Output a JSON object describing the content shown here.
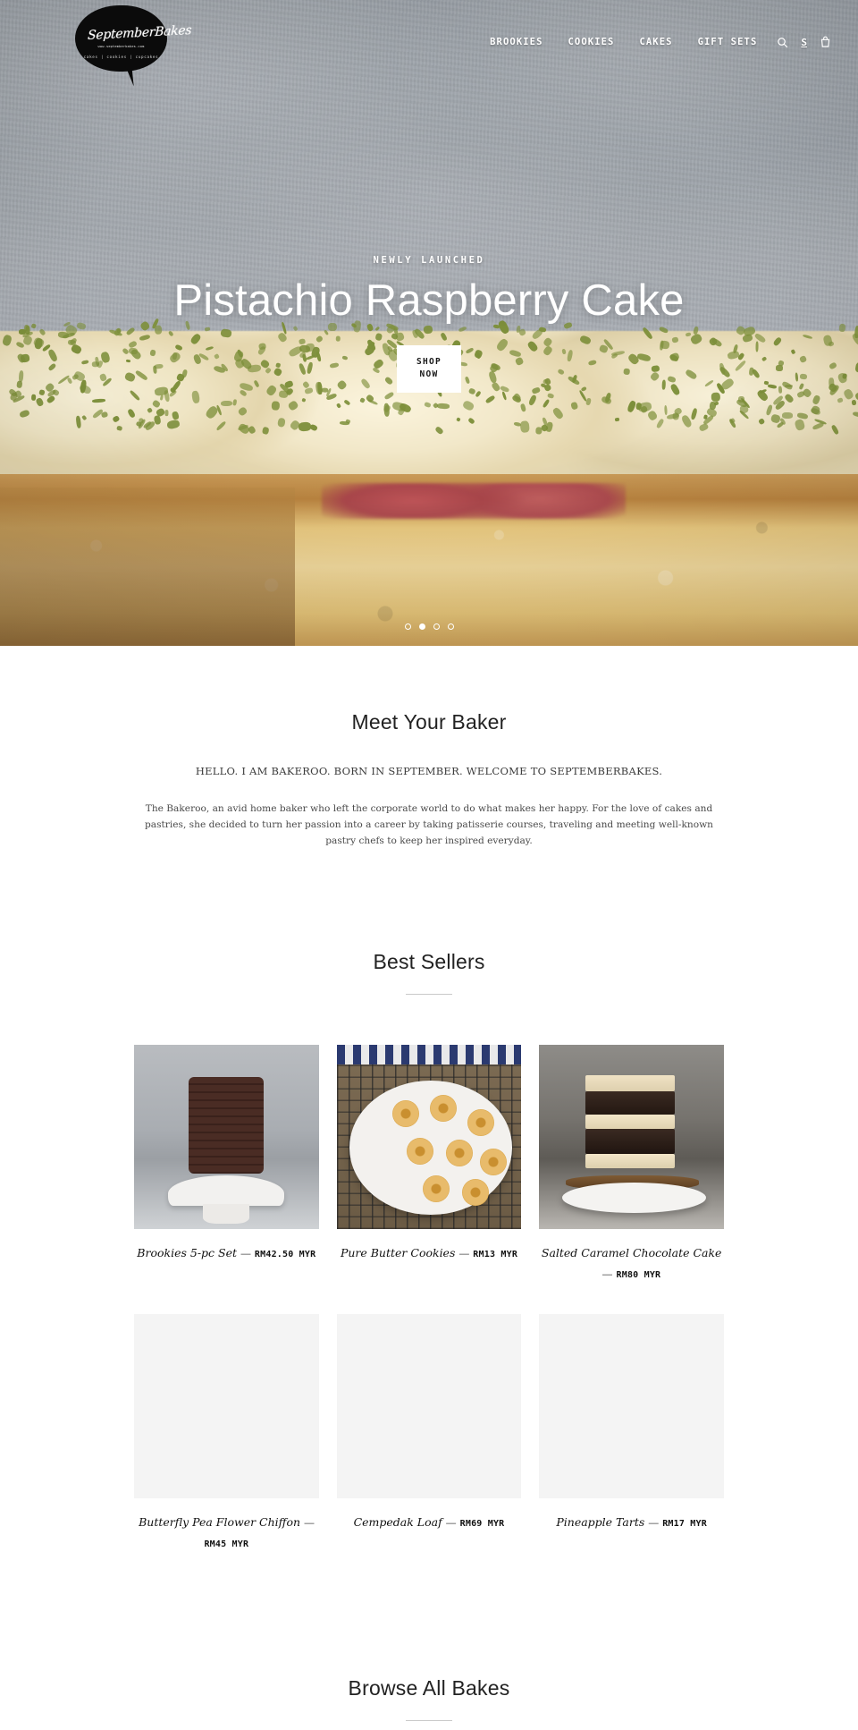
{
  "brand": {
    "name": "SeptemberBakes",
    "url_text": "www.septemberbakes.com",
    "tagline": "cakes | cookies | cupcakes"
  },
  "nav": {
    "items": [
      {
        "label": "BROOKIES"
      },
      {
        "label": "COOKIES"
      },
      {
        "label": "CAKES"
      },
      {
        "label": "GIFT SETS"
      }
    ],
    "icons": [
      {
        "name": "search-icon",
        "glyph": ""
      },
      {
        "name": "currency-selector",
        "glyph": "S"
      },
      {
        "name": "cart-icon",
        "glyph": ""
      }
    ]
  },
  "hero": {
    "eyebrow": "NEWLY LAUNCHED",
    "title": "Pistachio Raspberry Cake",
    "cta": "SHOP\nNOW",
    "cta_line1": "SHOP",
    "cta_line2": "NOW",
    "slides_total": 4,
    "active_slide": 2
  },
  "about": {
    "title": "Meet Your Baker",
    "lede": "HELLO. I AM BAKEROO. BORN IN SEPTEMBER. WELCOME TO SEPTEMBERBAKES.",
    "body": "The Bakeroo, an avid home baker who left the corporate world to do what makes her happy. For the love of cakes and pastries, she decided to turn her passion into a career by taking patisserie courses, traveling and meeting well-known pastry chefs to keep her inspired everyday."
  },
  "best_sellers": {
    "title": "Best Sellers",
    "products": [
      {
        "name": "Brookies 5-pc Set",
        "sep": "—",
        "price": "RM42.50 MYR",
        "mark": "",
        "thumb": "brookies"
      },
      {
        "name": "Pure Butter Cookies",
        "sep": "—",
        "price": "RM13 MYR",
        "mark": "",
        "thumb": "cookies"
      },
      {
        "name": "Salted Caramel Chocolate Cake",
        "sep": "—",
        "price": "RM80 MYR",
        "mark": "",
        "thumb": "cake"
      },
      {
        "name": "Butterfly Pea Flower Chiffon",
        "sep": "—",
        "price": "RM45 MYR",
        "mark": "",
        "thumb": "empty"
      },
      {
        "name": "Cempedak Loaf",
        "sep": "—",
        "price": "RM69 MYR",
        "mark": "",
        "thumb": "empty"
      },
      {
        "name": "Pineapple Tarts",
        "sep": "—",
        "price": "RM17 MYR",
        "mark": "",
        "thumb": "empty"
      }
    ]
  },
  "browse": {
    "title": "Browse All Bakes"
  },
  "colors": {
    "text": "#111111",
    "muted": "#4a4a4a",
    "rule": "#c9c9c9",
    "hero_overlay": "#ffffff"
  }
}
